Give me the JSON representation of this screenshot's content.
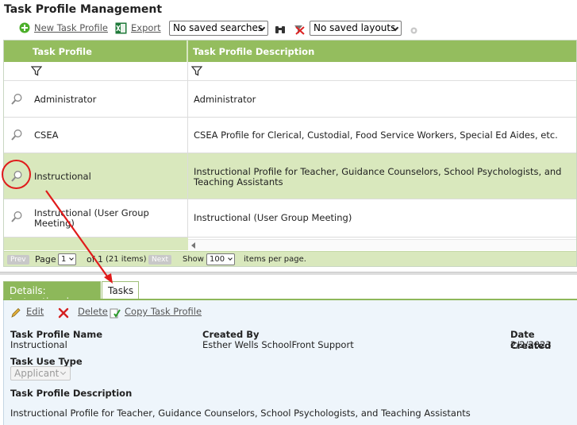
{
  "page": {
    "title": "Task Profile Management"
  },
  "toolbar": {
    "new_label": "New Task Profile",
    "export_label": "Export",
    "saved_searches": "No saved searches",
    "saved_layouts": "No saved layouts"
  },
  "grid": {
    "columns": [
      "Task Profile",
      "Task Profile Description"
    ],
    "rows": [
      {
        "name": "Administrator",
        "description": "Administrator"
      },
      {
        "name": "CSEA",
        "description": "CSEA Profile for Clerical, Custodial, Food Service Workers, Special Ed Aides, etc."
      },
      {
        "name": "Instructional",
        "description": "Instructional Profile for Teacher, Guidance Counselors, School Psychologists, and Teaching Assistants"
      },
      {
        "name": "Instructional (User Group Meeting)",
        "description": "Instructional (User Group Meeting)"
      }
    ]
  },
  "pager": {
    "prev": "Prev",
    "page_label": "Page",
    "page_value": "1",
    "of_label": "of",
    "page_count": "1",
    "items": "(21  items)",
    "next": "Next",
    "show_label": "Show",
    "per_page_value": "100",
    "per_page_label": "items per page."
  },
  "tabs": [
    "Details: Instructional",
    "Tasks"
  ],
  "details": {
    "edit": "Edit",
    "delete": "Delete",
    "copy": "Copy Task Profile",
    "name_label": "Task Profile Name",
    "name_value": "Instructional",
    "created_by_label": "Created By",
    "created_by_value": "Esther Wells SchoolFront Support",
    "date_created_label": "Date Created",
    "date_created_value": "2/2/2023",
    "use_type_label": "Task Use Type",
    "use_type_value": "Applicant",
    "description_label": "Task Profile Description",
    "description_value": "Instructional Profile for Teacher, Guidance Counselors, School Psychologists, and Teaching Assistants"
  },
  "colors": {
    "accent": "#94bd5e",
    "selected_row": "#d9e8bd",
    "annotation": "#e01b1b",
    "details_bg": "#eef5fb"
  }
}
